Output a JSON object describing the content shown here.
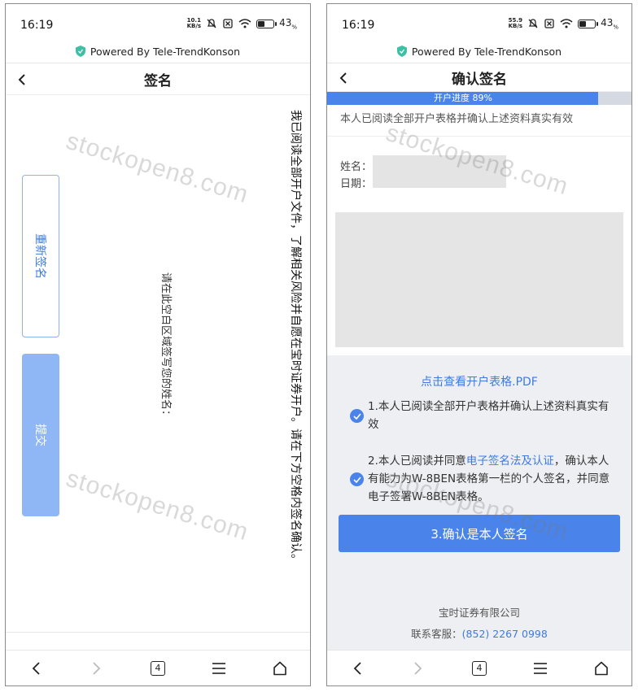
{
  "left": {
    "status": {
      "time": "16:19",
      "net_speed_value": "10.1",
      "net_speed_unit": "KB/s",
      "battery_pct": "43",
      "battery_unit": "%"
    },
    "powered_by": "Powered By Tele-TrendKonson",
    "title": "签名",
    "declaration": "我已阅读全部开户文件，了解相关风险并自愿在宝时证券开户。请在下方空格内签名确认。",
    "hint": "请在此空白区域签写您的姓名：",
    "resign_label": "重新签名",
    "submit_label": "提交",
    "watermark": "stockopen8.com",
    "nav": {
      "tabs_count": "4"
    }
  },
  "right": {
    "status": {
      "time": "16:19",
      "net_speed_value": "55.9",
      "net_speed_unit": "KB/s",
      "battery_pct": "43",
      "battery_unit": "%"
    },
    "powered_by": "Powered By Tele-TrendKonson",
    "title": "确认签名",
    "progress_label": "开户进度 89%",
    "progress_value": 0.89,
    "confirm_line": "本人已阅读全部开户表格并确认上述资料真实有效",
    "name_label": "姓名：",
    "date_label": "日期：",
    "pdf_link": "点击查看开户表格.PDF",
    "agree1": "1.本人已阅读全部开户表格并确认上述资料真实有效",
    "agree2_prefix": "2.本人已阅读并同意",
    "agree2_link": "电子签名法及认证",
    "agree2_suffix": "，确认本人有能力为W-8BEN表格第一栏的个人签名，并同意电子签署W-8BEN表格。",
    "confirm_button": "3.确认是本人签名",
    "company": "宝时证券有限公司",
    "service_label": "联系客服：",
    "service_phone": "(852) 2267 0998",
    "watermark": "stockopen8.com",
    "nav": {
      "tabs_count": "4"
    }
  },
  "colors": {
    "accent": "#4a84ea",
    "link": "#3d7be0",
    "light_button": "#8fb6f5",
    "grey_bg": "#eeeff3"
  }
}
